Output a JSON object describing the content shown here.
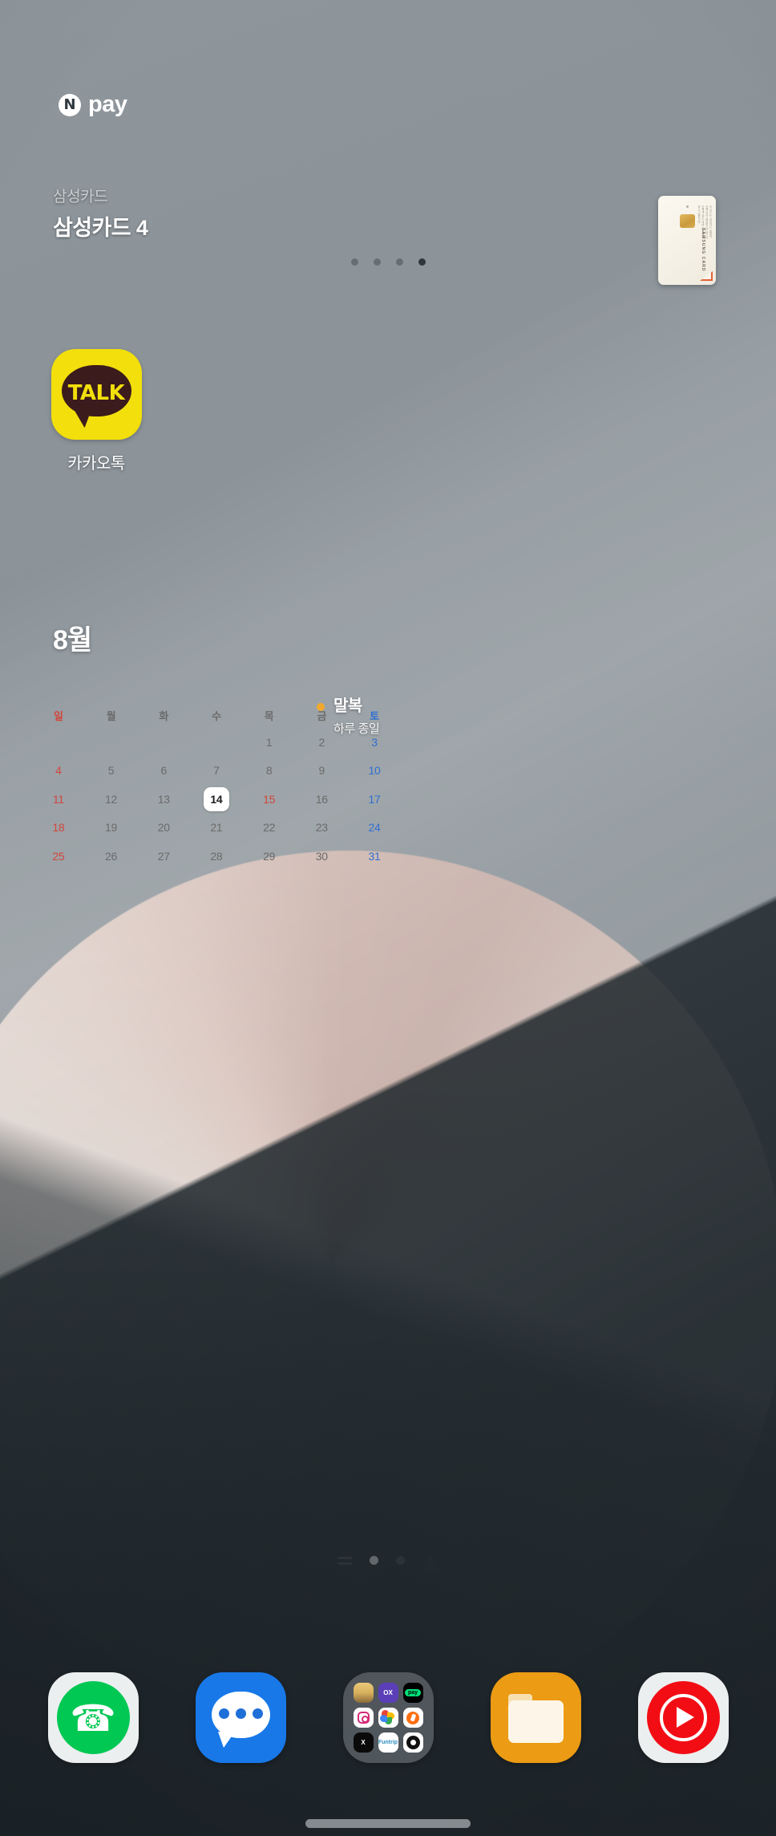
{
  "npay_widget": {
    "logo_mark": "N",
    "logo_text": "pay",
    "card_issuer": "삼성카드",
    "card_name": "삼성카드 4",
    "card_brand_text": "SAMSUNG CARD",
    "card_fineprint": "이 카드는 삼성카드 회원약관에 따라 발급된 카드로 타인에게 양도 대여 담보제공 할 수 없습니다",
    "page_dots": [
      {
        "active": false
      },
      {
        "active": false
      },
      {
        "active": false
      },
      {
        "active": true
      }
    ]
  },
  "apps": [
    {
      "name": "kakaotalk",
      "label": "카카오톡",
      "icon": "kakaotalk-icon",
      "glyph_text": "TALK",
      "bg_color": "#f2df0b",
      "fg_color": "#3b1b1b"
    }
  ],
  "calendar_widget": {
    "month_label": "8월",
    "weekday_headers": [
      {
        "label": "일",
        "kind": "sun"
      },
      {
        "label": "월",
        "kind": "wd"
      },
      {
        "label": "화",
        "kind": "wd"
      },
      {
        "label": "수",
        "kind": "wd"
      },
      {
        "label": "목",
        "kind": "wd"
      },
      {
        "label": "금",
        "kind": "wd"
      },
      {
        "label": "토",
        "kind": "sat"
      }
    ],
    "weeks": [
      [
        {
          "label": "",
          "kind": "empty"
        },
        {
          "label": "",
          "kind": "empty"
        },
        {
          "label": "",
          "kind": "empty"
        },
        {
          "label": "",
          "kind": "empty"
        },
        {
          "label": "1",
          "kind": "dim"
        },
        {
          "label": "2",
          "kind": "dim"
        },
        {
          "label": "3",
          "kind": "sat"
        }
      ],
      [
        {
          "label": "4",
          "kind": "sun"
        },
        {
          "label": "5",
          "kind": "dim"
        },
        {
          "label": "6",
          "kind": "dim"
        },
        {
          "label": "7",
          "kind": "dim"
        },
        {
          "label": "8",
          "kind": "dim"
        },
        {
          "label": "9",
          "kind": "dim"
        },
        {
          "label": "10",
          "kind": "sat"
        }
      ],
      [
        {
          "label": "11",
          "kind": "sun"
        },
        {
          "label": "12",
          "kind": "dim"
        },
        {
          "label": "13",
          "kind": "dim"
        },
        {
          "label": "14",
          "kind": "today"
        },
        {
          "label": "15",
          "kind": "hol"
        },
        {
          "label": "16",
          "kind": "dim"
        },
        {
          "label": "17",
          "kind": "sat"
        }
      ],
      [
        {
          "label": "18",
          "kind": "sun"
        },
        {
          "label": "19",
          "kind": "dim"
        },
        {
          "label": "20",
          "kind": "dim"
        },
        {
          "label": "21",
          "kind": "dim"
        },
        {
          "label": "22",
          "kind": "dim"
        },
        {
          "label": "23",
          "kind": "dim"
        },
        {
          "label": "24",
          "kind": "sat"
        }
      ],
      [
        {
          "label": "25",
          "kind": "sun"
        },
        {
          "label": "26",
          "kind": "dim"
        },
        {
          "label": "27",
          "kind": "dim"
        },
        {
          "label": "28",
          "kind": "dim"
        },
        {
          "label": "29",
          "kind": "dim"
        },
        {
          "label": "30",
          "kind": "dim"
        },
        {
          "label": "31",
          "kind": "sat"
        }
      ]
    ],
    "today": "14",
    "event": {
      "title": "말복",
      "subtitle": "하루 종일",
      "dot_color": "#f0a92c"
    },
    "colors": {
      "sunday": "#d2453c",
      "saturday": "#2f6fd0",
      "weekday": "#6a6a6a",
      "today_bg": "#ffffff",
      "today_fg": "#1c1c1c"
    }
  },
  "home_indicator": {
    "items": [
      {
        "type": "lines",
        "name": "recents-pages-icon",
        "active": false
      },
      {
        "type": "dot",
        "name": "page-dot-1",
        "active": false
      },
      {
        "type": "dot",
        "name": "page-dot-2",
        "active": true
      },
      {
        "type": "home",
        "name": "home-page-icon",
        "active": false
      }
    ]
  },
  "dock": {
    "items": [
      {
        "name": "phone",
        "label": "전화",
        "icon": "phone-icon",
        "glyph": "✆",
        "color": "#00c853"
      },
      {
        "name": "messages",
        "label": "메시지",
        "icon": "messages-icon",
        "color": "#1878e8"
      },
      {
        "name": "app-folder",
        "label": "폴더",
        "icon": "folder-icon",
        "color": "#5c6369"
      },
      {
        "name": "my-files",
        "label": "내 파일",
        "icon": "files-icon",
        "color": "#eb9b14"
      },
      {
        "name": "youtube-music",
        "label": "YouTube Music",
        "icon": "youtube-music-icon",
        "color": "#f20d15"
      }
    ],
    "folder_apps": [
      {
        "name": "game",
        "label": "게임"
      },
      {
        "name": "ox-puzzle",
        "label": "OX"
      },
      {
        "name": "naver-pay",
        "label": "pay"
      },
      {
        "name": "instagram",
        "label": "Instagram"
      },
      {
        "name": "google-photos",
        "label": "Photos"
      },
      {
        "name": "daangn",
        "label": "당근"
      },
      {
        "name": "x-twitter",
        "label": "X"
      },
      {
        "name": "funtrip",
        "label": "Funtrip"
      },
      {
        "name": "daum",
        "label": "Daum"
      }
    ]
  },
  "wallpaper": {
    "base_color": "#8d959b",
    "accent_color": "#cdb5ae",
    "dark_color": "#1e262b"
  }
}
